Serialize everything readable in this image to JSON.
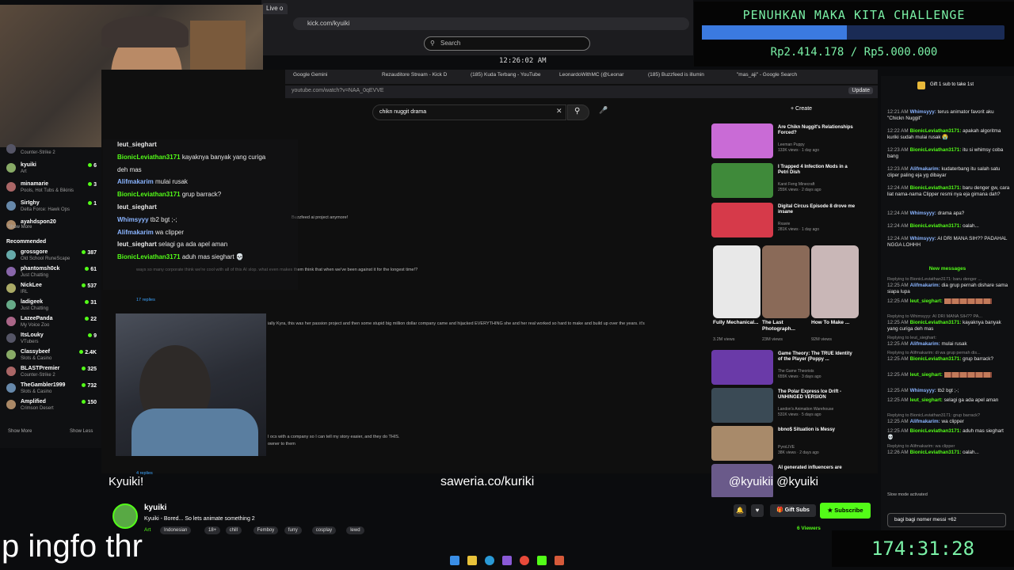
{
  "browser": {
    "tab_label": "Live o",
    "url": "kick.com/kyuiki",
    "search_placeholder": "Search",
    "clock": "12:26:02 AM"
  },
  "goal": {
    "title": "PENUHKAN MAKA KITA CHALLENGE",
    "amount": "Rp2.414.178 / Rp5.000.000",
    "progress_fraction": 0.48
  },
  "sidebar": {
    "channels": [
      {
        "name": "",
        "category": "Counter-Strike 2",
        "count": ""
      },
      {
        "name": "kyuiki",
        "category": "Art",
        "count": "6"
      },
      {
        "name": "minamarie",
        "category": "Pools, Hot Tubs & Bikinis",
        "count": "3"
      },
      {
        "name": "SirIghy",
        "category": "Delta Force: Hawk Ops",
        "count": "1"
      },
      {
        "name": "ayahdspon20",
        "category": "",
        "count": ""
      }
    ],
    "show_more": "Show More",
    "recommended_header": "Recommended",
    "recommended": [
      {
        "name": "grossgore",
        "category": "Old School RuneScape",
        "count": "387"
      },
      {
        "name": "phantomsh0ck",
        "category": "Just Chatting",
        "count": "61"
      },
      {
        "name": "NickLee",
        "category": "IRL",
        "count": "537"
      },
      {
        "name": "ladigeek",
        "category": "Just Chatting",
        "count": "31"
      },
      {
        "name": "LazeePanda",
        "category": "My Voice Zoo",
        "count": "22"
      },
      {
        "name": "ItsLouky",
        "category": "VTubers",
        "count": "9"
      },
      {
        "name": "Classybeef",
        "category": "Slots & Casino",
        "count": "2.4K"
      },
      {
        "name": "BLASTPremier",
        "category": "Counter-Strike 2",
        "count": "325"
      },
      {
        "name": "TheGambler1999",
        "category": "Slots & Casino",
        "count": "732"
      },
      {
        "name": "Amplified",
        "category": "Crimson Desert",
        "count": "150"
      }
    ],
    "show_more_2": "Show More",
    "show_less": "Show Less"
  },
  "youtube": {
    "tabs": [
      "Google Gemini",
      "Rezauditore Stream - Kick D",
      "(185) Kuda Terbang - YouTube",
      "LeonardoWithMC (@Leonar",
      "(185) Buzzfeed is illumin",
      "\"mas_aji\" - Google Search"
    ],
    "url": "youtube.com/watch?v=NAA_0qEVVE",
    "search_query": "chikn nuggit drama",
    "create_label": "+ Create",
    "update_label": "Update",
    "comment_1": "Buzzfeed ai project anymore!",
    "comment_2": "ways so many corporate think we're cool with all of this AI slop. what even makes them think that when we've been against it for the longest time!?",
    "replies_1": "17 replies",
    "comment_3": "ially Kyra, this was her passion project and then some stupid big million dollar company came and hijacked EVERYTHING she and her real worked so hard to make and build up over the years. it's",
    "comment_4": "I ocs with a company so I can tell my story easier, and they do THIS.",
    "comment_4b": "owner to them",
    "replies_2": "4 replies",
    "recommendations": [
      {
        "title": "Are Chikn Nuggit's Relationships Forced?",
        "channel": "Leeman Puppy",
        "meta": "133K views · 1 day ago",
        "color": "#c96bd6"
      },
      {
        "title": "I Trapped 4 Infection Mods in a Petri Dish",
        "channel": "Karst Feng Minecraft",
        "meta": "255K views · 2 days ago",
        "color": "#3f8a3a"
      },
      {
        "title": "Digital Circus Episode 8 drove me insane",
        "channel": "Rxavie",
        "meta": "281K views · 1 day ago",
        "color": "#d63a4a"
      }
    ],
    "shorts": [
      {
        "title": "Fully Mechanical...",
        "views": "3.2M views",
        "color": "#e8e8e8"
      },
      {
        "title": "The Last Photograph...",
        "views": "23M views",
        "color": "#8a6a58"
      },
      {
        "title": "How To Make ...",
        "views": "92M views",
        "color": "#c9b7b7"
      }
    ],
    "recommendations_2": [
      {
        "title": "Game Theory: The TRUE Identity of the Player (Poppy ...",
        "channel": "The Game Theorists",
        "meta": "655K views · 3 days ago",
        "color": "#6a3aa8"
      },
      {
        "title": "The Polar Express Ice Drift - UNHINGED VERSION",
        "channel": "Landon's Animation Warehouse",
        "meta": "531K views · 5 days ago",
        "color": "#3a4a55"
      },
      {
        "title": "bbno$ Situation is Messy",
        "channel": "PyroLIVE",
        "meta": "38K views · 2 days ago",
        "color": "#a88a6a"
      },
      {
        "title": "AI generated influencers are",
        "channel": "",
        "meta": "",
        "color": "#6a5a8a"
      }
    ]
  },
  "overlay_chat": [
    {
      "user": "leut_sieghart",
      "text": "",
      "color": "#e8e8e8"
    },
    {
      "user": "BionicLeviathan3171",
      "text": "kayaknya banyak yang curiga",
      "color": "#53fc18"
    },
    {
      "user": "",
      "text": "deh mas",
      "color": "#e8e8e8"
    },
    {
      "user": "Alifmakarim",
      "text": "mulai rusak",
      "color": "#8ab4ff"
    },
    {
      "user": "BionicLeviathan3171",
      "text": "grup barrack?",
      "color": "#53fc18"
    },
    {
      "user": "leut_sieghart",
      "text": "",
      "color": "#e8e8e8"
    },
    {
      "user": "Whimsyyy",
      "text": "tb2 bgt ;-;",
      "color": "#8ab4ff"
    },
    {
      "user": "Alifmakarim",
      "text": "wa clipper",
      "color": "#8ab4ff"
    },
    {
      "user": "leut_sieghart",
      "text": "selagi ga ada apel aman",
      "color": "#e8e8e8"
    },
    {
      "user": "BionicLeviathan3171",
      "text": "aduh mas sieghart 💀",
      "color": "#53fc18"
    }
  ],
  "overlays": {
    "name": "Kyuiki!",
    "saweria": "saweria.co/kuriki",
    "social": "@kyuikii  @kyuiki"
  },
  "stream": {
    "streamer": "kyuiki",
    "title": "Kyuiki - Bored... So lets animate something 2",
    "category": "Art",
    "tags": [
      "Indonesian",
      "18+",
      "chill",
      "Femboy",
      "furry",
      "cosplay",
      "lewd"
    ],
    "gift_subs": "Gift Subs",
    "subscribe": "Subscribe",
    "viewers": "6 Viewers"
  },
  "chat": {
    "gift_prompt": "Gift 1 sub to take 1st",
    "messages": [
      {
        "time": "12:21 AM",
        "user": "Whimsyyy:",
        "text": "terus animator favorit aku \"Chickn Nuggit\"",
        "color": "#8ab4ff"
      },
      {
        "time": "12:22 AM",
        "user": "BionicLeviathan3171:",
        "text": "apakah algoritma kuriki sudah mulai rusak 😭",
        "color": "#53fc18"
      },
      {
        "time": "12:23 AM",
        "user": "BionicLeviathan3171:",
        "text": "itu si whimsy coba bang",
        "color": "#53fc18"
      },
      {
        "time": "12:23 AM",
        "user": "Alifmakarim:",
        "text": "kudaterbang itu salah satu cliper paling eja yg dibayar",
        "color": "#8ab4ff"
      },
      {
        "time": "12:24 AM",
        "user": "BionicLeviathan3171:",
        "text": "baru denger gw, cara liat nama-nama Clipper resmi nya eja gimana dah?",
        "color": "#53fc18"
      },
      {
        "time": "12:24 AM",
        "user": "Whimsyyy:",
        "text": "drama apa?",
        "color": "#8ab4ff"
      },
      {
        "time": "12:24 AM",
        "user": "BionicLeviathan3171:",
        "text": "oalah...",
        "color": "#53fc18"
      },
      {
        "time": "12:24 AM",
        "user": "Whimsyyy:",
        "text": "AI DRI MANA SIH?? PADAHAL NGGA LOHHH",
        "color": "#8ab4ff"
      }
    ],
    "new_messages_label": "New messages",
    "messages_2": [
      {
        "reply": "Replying to BionicLeviathan3171: baru denger ...",
        "time": "12:25 AM",
        "user": "Alifmakarim:",
        "text": "dia grup pernah dishare sama siapa lupa",
        "color": "#8ab4ff"
      },
      {
        "reply": "",
        "time": "12:25 AM",
        "user": "leut_sieghart:",
        "text": "",
        "color": "#53fc18"
      },
      {
        "reply": "Replying to Whimsyyy: AI DRI MANA SIH?? PA...",
        "time": "12:25 AM",
        "user": "BionicLeviathan3171:",
        "text": "kayaknya banyak yang curiga deh mas",
        "color": "#53fc18"
      },
      {
        "reply": "Replying to leut_sieghart:",
        "time": "12:25 AM",
        "user": "Alifmakarim:",
        "text": "mulai rusak",
        "color": "#8ab4ff"
      },
      {
        "reply": "Replying to Alifmakarim: di wa grup pernah dis...",
        "time": "12:25 AM",
        "user": "BionicLeviathan3171:",
        "text": "grup barrack?",
        "color": "#53fc18"
      },
      {
        "reply": "",
        "time": "12:25 AM",
        "user": "leut_sieghart:",
        "text": "",
        "color": "#53fc18"
      },
      {
        "reply": "",
        "time": "12:25 AM",
        "user": "Whimsyyy:",
        "text": "tb2 bgt ;-;",
        "color": "#8ab4ff"
      },
      {
        "reply": "",
        "time": "12:25 AM",
        "user": "leut_sieghart:",
        "text": "selagi ga ada apel aman",
        "color": "#53fc18"
      },
      {
        "reply": "Replying to BionicLeviathan3171: grup barrack?",
        "time": "12:25 AM",
        "user": "Alifmakarim:",
        "text": "wa clipper",
        "color": "#8ab4ff"
      },
      {
        "reply": "",
        "time": "12:25 AM",
        "user": "BionicLeviathan3171:",
        "text": "aduh mas sieghart 💀",
        "color": "#53fc18"
      },
      {
        "reply": "Replying to Alifmakarim: wa clipper",
        "time": "12:26 AM",
        "user": "BionicLeviathan3171:",
        "text": "oalah...",
        "color": "#53fc18"
      }
    ],
    "slow_mode": "Slow mode activated",
    "input_value": "bagi bagi nomer messi +62"
  },
  "timer": "174:31:28",
  "caption": "p ingfo thr"
}
